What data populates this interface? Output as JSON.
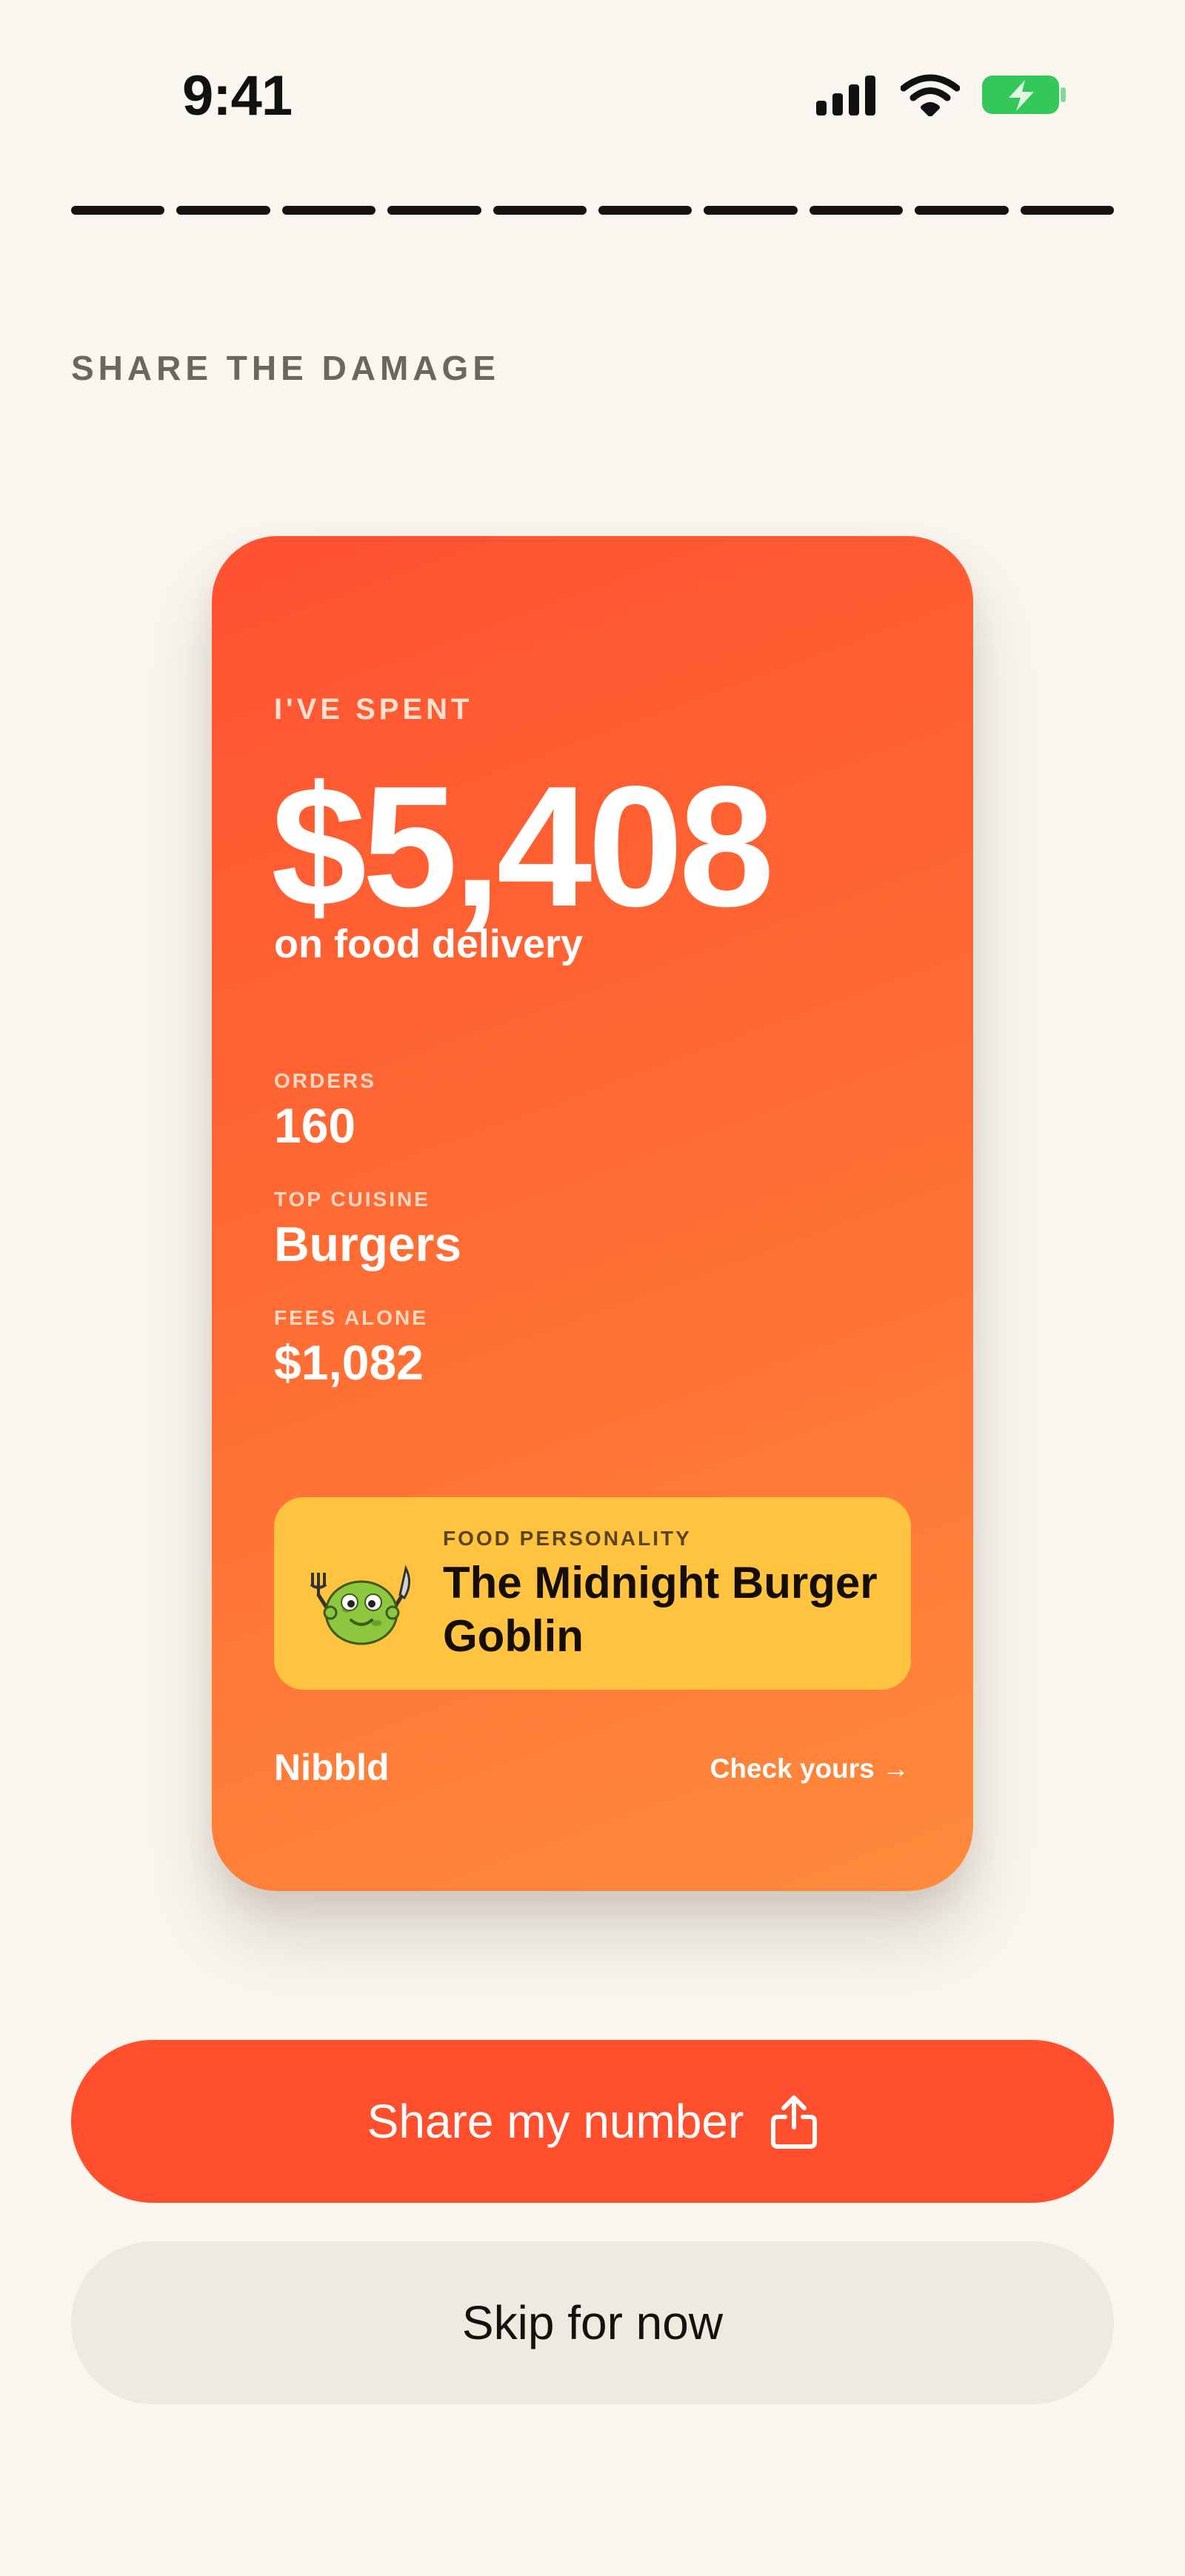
{
  "status_bar": {
    "time": "9:41",
    "icons": [
      "signal-icon",
      "wifi-icon",
      "battery-charging-icon"
    ],
    "battery_color": "#34c759"
  },
  "progress": {
    "segments_total": 10,
    "segments_complete": 10
  },
  "section_label": "SHARE THE DAMAGE",
  "card": {
    "eyebrow": "I'VE SPENT",
    "amount": "$5,408",
    "subtitle": "on food delivery",
    "stats": [
      {
        "label": "ORDERS",
        "value": "160"
      },
      {
        "label": "TOP CUISINE",
        "value": "Burgers"
      },
      {
        "label": "FEES ALONE",
        "value": "$1,082"
      }
    ],
    "personality": {
      "label": "FOOD PERSONALITY",
      "name": "The Midnight Burger Goblin",
      "mascot_icon": "goblin-mascot-icon"
    },
    "brand": "Nibbld",
    "cta": "Check yours →",
    "gradient_colors": [
      "#ff5131",
      "#ff8a3c"
    ],
    "persona_color": "#ffc33f"
  },
  "buttons": {
    "share_label": "Share my number",
    "share_icon": "share-icon",
    "skip_label": "Skip for now",
    "accent_color": "#ff4f2c"
  }
}
